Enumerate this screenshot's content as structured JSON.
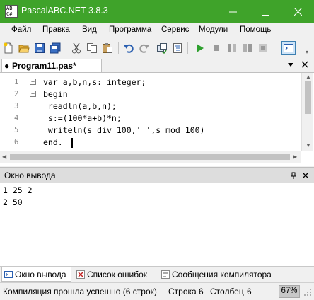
{
  "window": {
    "title": "PascalABC.NET 3.8.3",
    "app_icon_text": [
      "AB",
      "C#"
    ],
    "accent": "#3fa32a"
  },
  "menu": {
    "items": [
      "Файл",
      "Правка",
      "Вид",
      "Программа",
      "Сервис",
      "Модули",
      "Помощь"
    ]
  },
  "toolbar": {
    "icons": [
      "new-file-icon",
      "open-folder-icon",
      "save-icon",
      "save-all-icon",
      "cut-icon",
      "copy-icon",
      "paste-icon",
      "undo-icon",
      "redo-icon",
      "compile-icon",
      "format-icon",
      "run-icon",
      "stop-icon",
      "step-icon",
      "step-into-icon",
      "output-window-icon"
    ]
  },
  "editor": {
    "tab": {
      "label": "Program11.pas*",
      "mark": "●"
    },
    "lines": [
      "var a,b,n,s: integer;",
      "begin",
      " readln(a,b,n);",
      " s:=(100*a+b)*n;",
      " writeln(s div 100,' ',s mod 100)",
      "end."
    ],
    "line_numbers": [
      "1",
      "2",
      "3",
      "4",
      "5",
      "6"
    ]
  },
  "output_panel": {
    "title": "Окно вывода",
    "lines": [
      "1 25 2",
      "2 50"
    ]
  },
  "bottom_tabs": [
    {
      "label": "Окно вывода",
      "active": true,
      "icon": "output-window-icon"
    },
    {
      "label": "Список ошибок",
      "active": false,
      "icon": "error-list-icon"
    },
    {
      "label": "Сообщения компилятора",
      "active": false,
      "icon": "compiler-messages-icon"
    }
  ],
  "status": {
    "message": "Компиляция прошла успешно (6 строк)",
    "line_label": "Строка",
    "line_value": "6",
    "col_label": "Столбец",
    "col_value": "6",
    "zoom": "67%"
  }
}
